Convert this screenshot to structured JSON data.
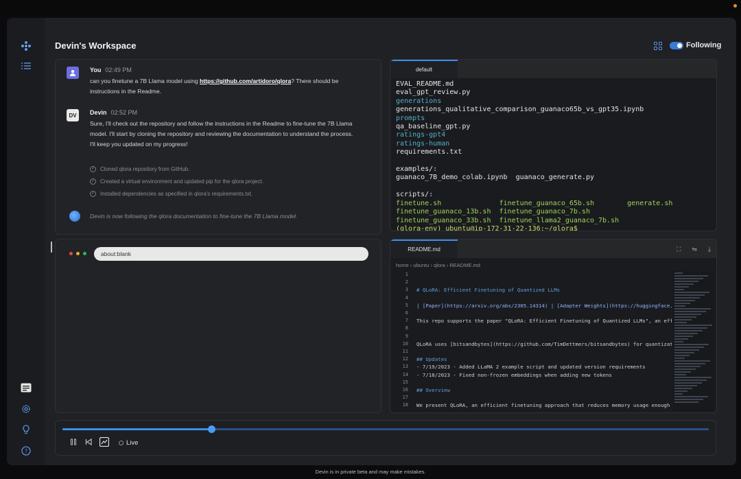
{
  "workspace": {
    "title": "Devin's Workspace",
    "follow_label": "Following"
  },
  "chat": {
    "messages": [
      {
        "author": "You",
        "avatar": "",
        "time": "02:49 PM",
        "text_before": "can you finetune a 7B Llama model using ",
        "link": "https://github.com/artidoro/qlora",
        "text_after": "? There should be instructions in the Readme."
      },
      {
        "author": "Devin",
        "avatar": "DV",
        "time": "02:52 PM",
        "text": "Sure, I'll check out the repository and follow the instructions in the Readme to fine-tune the 7B Llama model. I'll start by cloning the repository and reviewing the documentation to understand the process. I'll keep you updated on my progress!"
      }
    ],
    "steps": [
      "Cloned qlora repository from GitHub.",
      "Created a virtual environment and updated pip for the qlora project.",
      "Installed dependencies as specified in qlora's requirements.txt."
    ],
    "status": "Devin is now following the qlora documentation to fine-tune the 7B Llama model."
  },
  "terminal": {
    "tab": "default",
    "lines": [
      {
        "t": "EVAL_README.md",
        "c": ""
      },
      {
        "t": "eval_gpt_review.py",
        "c": ""
      },
      {
        "t": "generations",
        "c": "c-cyan"
      },
      {
        "t": "generations_qualitative_comparison_guanaco65b_vs_gpt35.ipynb",
        "c": ""
      },
      {
        "t": "prompts",
        "c": "c-cyan"
      },
      {
        "t": "qa_baseline_gpt.py",
        "c": ""
      },
      {
        "t": "ratings-gpt4",
        "c": "c-cyan"
      },
      {
        "t": "ratings-human",
        "c": "c-cyan"
      },
      {
        "t": "requirements.txt",
        "c": ""
      },
      {
        "t": "",
        "c": ""
      },
      {
        "t": "examples/:",
        "c": ""
      },
      {
        "t": "guanaco_7B_demo_colab.ipynb  guanaco_generate.py",
        "c": ""
      },
      {
        "t": "",
        "c": ""
      },
      {
        "t": "scripts/:",
        "c": ""
      },
      {
        "t": "finetune.sh              finetune_guanaco_65b.sh        generate.sh",
        "c": "c-green"
      },
      {
        "t": "finetune_guanaco_13b.sh  finetune_guanaco_7b.sh",
        "c": "c-green"
      },
      {
        "t": "finetune_guanaco_33b.sh  finetune_llama2_guanaco_7b.sh",
        "c": "c-green"
      },
      {
        "t": "(qlora-env) ubuntu@ip-172-31-22-136:~/qlora$",
        "c": "c-lime"
      }
    ]
  },
  "browser": {
    "url": "about:blank"
  },
  "editor": {
    "tab": "README.md",
    "breadcrumb": "home  ›  ubuntu  ›  qlora  ›  README.md",
    "line_numbers": [
      "1",
      "2",
      "3",
      "4",
      "5",
      "6",
      "7",
      "8",
      "9",
      "10",
      "11",
      "12",
      "13",
      "14",
      "15",
      "16",
      "17",
      "18"
    ],
    "lines": [
      {
        "t": "",
        "c": ""
      },
      {
        "t": "",
        "c": ""
      },
      {
        "t": "# QLoRA: Efficient Finetuning of Quantized LLMs",
        "c": "k-h"
      },
      {
        "t": "",
        "c": ""
      },
      {
        "t": "| [Paper](https://arxiv.org/abs/2305.14314) | [Adapter Weights](https://huggingface.co/timdettmers)",
        "c": "k-u"
      },
      {
        "t": "",
        "c": ""
      },
      {
        "t": "This repo supports the paper \"QLoRA: Efficient Finetuning of Quantized LLMs\", an effort to democ",
        "c": ""
      },
      {
        "t": "",
        "c": ""
      },
      {
        "t": "",
        "c": ""
      },
      {
        "t": "QLoRA uses [bitsandbytes](https://github.com/TimDettmers/bitsandbytes) for quantization and is in",
        "c": ""
      },
      {
        "t": "",
        "c": ""
      },
      {
        "t": "## Updates",
        "c": "k-h"
      },
      {
        "t": "- 7/19/2023 - Added LLaMA 2 example script and updated version requirements",
        "c": ""
      },
      {
        "t": "- 7/18/2023 - Fixed non-frozen embeddings when adding new tokens",
        "c": ""
      },
      {
        "t": "",
        "c": ""
      },
      {
        "t": "## Overview",
        "c": "k-h"
      },
      {
        "t": "",
        "c": ""
      },
      {
        "t": "We present QLoRA, an efficient finetuning approach that reduces memory usage enough to finetune a",
        "c": ""
      }
    ]
  },
  "player": {
    "progress": 0.23,
    "live_label": "Live"
  },
  "footer": "Devin is in private beta and may make mistakes.",
  "colors": {
    "accent": "#3a8fe8",
    "background": "#202125"
  }
}
